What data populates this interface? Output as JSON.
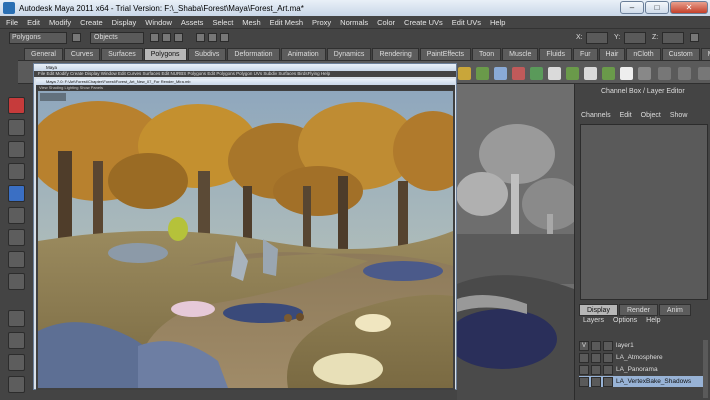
{
  "window": {
    "title": "Autodesk Maya 2011 x64 - Trial Version: F:\\_Shaba\\Forest\\Maya\\Forest_Art.ma*",
    "minimize": "–",
    "maximize": "□",
    "close": "✕"
  },
  "menubar": [
    "File",
    "Edit",
    "Modify",
    "Create",
    "Display",
    "Window",
    "Assets",
    "Select",
    "Mesh",
    "Edit Mesh",
    "Proxy",
    "Normals",
    "Color",
    "Create UVs",
    "Edit UVs",
    "Help"
  ],
  "statusline": {
    "mode": "Polygons",
    "object_field": "Objects",
    "x": "X:",
    "y": "Y:",
    "z": "Z:"
  },
  "shelf_tabs": [
    "General",
    "Curves",
    "Surfaces",
    "Polygons",
    "Subdivs",
    "Deformation",
    "Animation",
    "Dynamics",
    "Rendering",
    "PaintEffects",
    "Toon",
    "Muscle",
    "Fluids",
    "Fur",
    "Hair",
    "nCloth",
    "Custom",
    "Mirrona"
  ],
  "shelf_active": "Polygons",
  "render_window": {
    "title": "Maya",
    "menu": "File  Edit  Modify  Create  Display  Window  Edit Curves  Surfaces  Edit NURBS  Polygons  Edit Polygons  Polygon UVs  Subdiv Surfaces  BirdsFlying  Help",
    "inner_title": "Maya 7.0: F:\\Art\\Forest\\Chapter\\Forest\\Forest_Art_New_07_For Render_Mira.mb",
    "inner_menu": "View  Shading  Lighting  Show  Panels"
  },
  "channel_box": {
    "title": "Channel Box / Layer Editor",
    "menu": [
      "Channels",
      "Edit",
      "Object",
      "Show"
    ],
    "tabs": [
      "Display",
      "Render",
      "Anim"
    ],
    "active_tab": "Display",
    "layer_menu": [
      "Layers",
      "Options",
      "Help"
    ],
    "layers": [
      {
        "v": "V",
        "name": "layer1",
        "selected": false
      },
      {
        "v": "",
        "name": "LA_Atmosphere",
        "selected": false
      },
      {
        "v": "",
        "name": "LA_Panorama",
        "selected": false
      },
      {
        "v": "",
        "name": "LA_VertexBake_Shadows",
        "selected": true
      }
    ]
  },
  "colors": {
    "accent": "#98b3d6",
    "active_tab": "#b7b7b7"
  }
}
